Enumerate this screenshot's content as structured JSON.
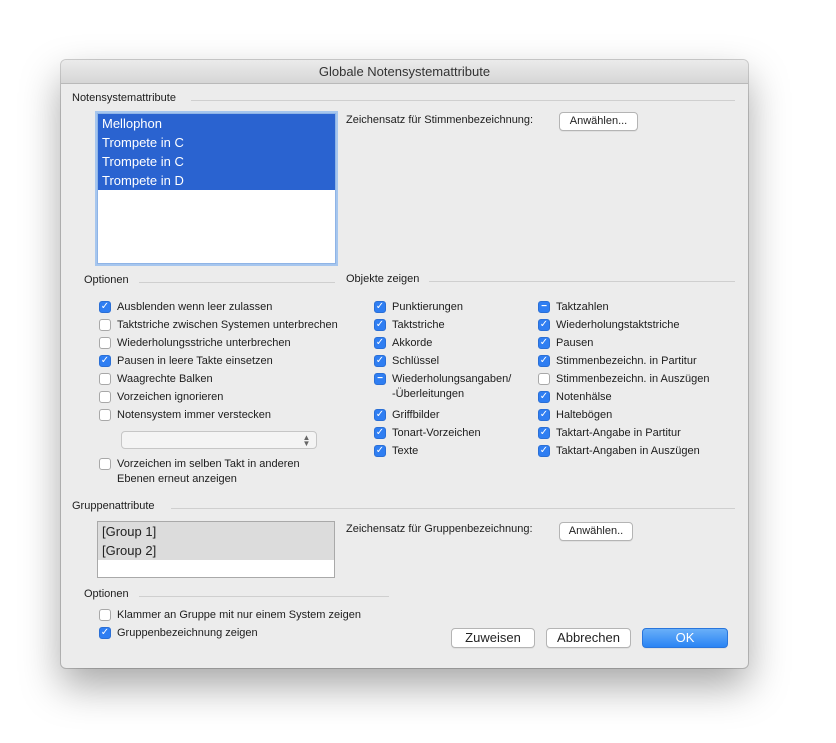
{
  "window": {
    "title": "Globale Notensystemattribute"
  },
  "staff_attributes": {
    "label": "Notensystemattribute",
    "items": [
      "Mellophon",
      "Trompete in C",
      "Trompete in C",
      "Trompete in D"
    ],
    "font_label": "Zeichensatz für Stimmenbezeichnung:",
    "font_button": "Anwählen..."
  },
  "options": {
    "label": "Optionen",
    "checkboxes": [
      {
        "label": "Ausblenden wenn leer zulassen",
        "state": "checked"
      },
      {
        "label": "Taktstriche zwischen Systemen unterbrechen",
        "state": "unchecked"
      },
      {
        "label": "Wiederholungsstriche unterbrechen",
        "state": "unchecked"
      },
      {
        "label": "Pausen in leere Takte einsetzen",
        "state": "checked"
      },
      {
        "label": "Waagrechte Balken",
        "state": "unchecked"
      },
      {
        "label": "Vorzeichen ignorieren",
        "state": "unchecked"
      },
      {
        "label": "Notensystem immer verstecken",
        "state": "unchecked"
      }
    ],
    "select_value": "",
    "extra": {
      "line1": "Vorzeichen im selben Takt in anderen",
      "line2": "Ebenen erneut anzeigen",
      "state": "unchecked"
    }
  },
  "show_objects": {
    "label": "Objekte zeigen",
    "col1": [
      {
        "label": "Punktierungen",
        "state": "checked"
      },
      {
        "label": "Taktstriche",
        "state": "checked"
      },
      {
        "label": "Akkorde",
        "state": "checked"
      },
      {
        "label": "Schlüssel",
        "state": "checked"
      },
      {
        "label": "Wiederholungsangaben/",
        "label2": "-Überleitungen",
        "state": "mixed"
      },
      {
        "label": "Griffbilder",
        "state": "checked"
      },
      {
        "label": "Tonart-Vorzeichen",
        "state": "checked"
      },
      {
        "label": "Texte",
        "state": "checked"
      }
    ],
    "col2": [
      {
        "label": "Taktzahlen",
        "state": "mixed"
      },
      {
        "label": "Wiederholungstaktstriche",
        "state": "checked"
      },
      {
        "label": "Pausen",
        "state": "checked"
      },
      {
        "label": "Stimmenbezeichn. in Partitur",
        "state": "checked"
      },
      {
        "label": "Stimmenbezeichn. in Auszügen",
        "state": "unchecked"
      },
      {
        "label": "Notenhälse",
        "state": "checked"
      },
      {
        "label": "Haltebögen",
        "state": "checked"
      },
      {
        "label": "Taktart-Angabe in Partitur",
        "state": "checked"
      },
      {
        "label": "Taktart-Angaben in Auszügen",
        "state": "checked"
      }
    ]
  },
  "group_attributes": {
    "label": "Gruppenattribute",
    "items": [
      "[Group 1]",
      "[Group 2]"
    ],
    "font_label": "Zeichensatz für Gruppenbezeichnung:",
    "font_button": "Anwählen.."
  },
  "group_options": {
    "label": "Optionen",
    "checkboxes": [
      {
        "label": "Klammer an Gruppe mit nur einem System zeigen",
        "state": "unchecked"
      },
      {
        "label": "Gruppenbezeichnung zeigen",
        "state": "checked"
      }
    ]
  },
  "footer": {
    "assign": "Zuweisen",
    "cancel": "Abbrechen",
    "ok": "OK"
  },
  "colors": {
    "selection": "#2a63d0",
    "accent": "#2f7ef2",
    "window_bg": "#ececec"
  }
}
